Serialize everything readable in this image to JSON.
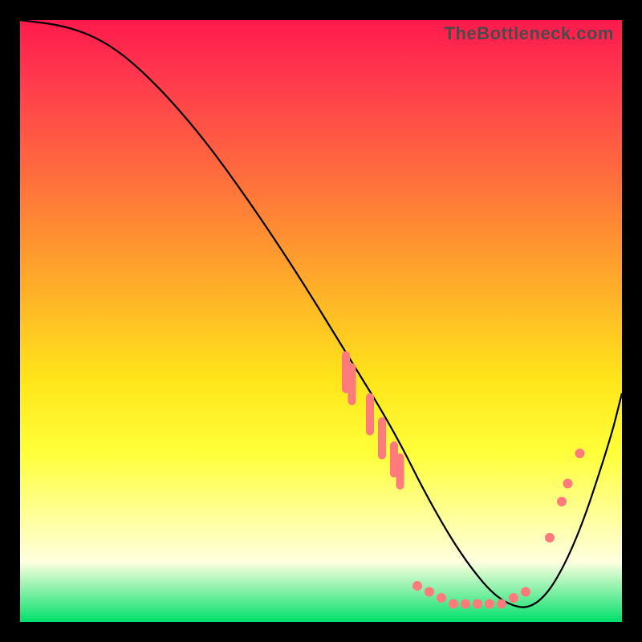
{
  "watermark": "TheBottleneck.com",
  "chart_data": {
    "type": "line",
    "title": "",
    "xlabel": "",
    "ylabel": "",
    "xlim": [
      0,
      100
    ],
    "ylim": [
      0,
      100
    ],
    "x": [
      0,
      8,
      15,
      22,
      30,
      38,
      46,
      54,
      62,
      68,
      74,
      80,
      86,
      92,
      98,
      100
    ],
    "values": [
      100,
      99,
      96,
      90,
      81,
      70,
      58,
      45,
      32,
      20,
      10,
      3,
      2,
      12,
      30,
      38
    ],
    "annotations": {
      "curve_highlight_bars": [
        {
          "x": 54,
          "y_top": 45,
          "y_bot": 38
        },
        {
          "x": 55,
          "y_top": 43,
          "y_bot": 36
        },
        {
          "x": 58,
          "y_top": 38,
          "y_bot": 31
        },
        {
          "x": 60,
          "y_top": 34,
          "y_bot": 27
        },
        {
          "x": 62,
          "y_top": 30,
          "y_bot": 24
        },
        {
          "x": 63,
          "y_top": 28,
          "y_bot": 22
        }
      ],
      "bottom_dots": [
        {
          "x": 66,
          "y": 6
        },
        {
          "x": 68,
          "y": 5
        },
        {
          "x": 70,
          "y": 4
        },
        {
          "x": 72,
          "y": 3
        },
        {
          "x": 74,
          "y": 3
        },
        {
          "x": 76,
          "y": 3
        },
        {
          "x": 78,
          "y": 3
        },
        {
          "x": 80,
          "y": 3
        },
        {
          "x": 82,
          "y": 4
        },
        {
          "x": 84,
          "y": 5
        }
      ],
      "rising_dots": [
        {
          "x": 88,
          "y": 14
        },
        {
          "x": 90,
          "y": 20
        },
        {
          "x": 91,
          "y": 23
        },
        {
          "x": 93,
          "y": 28
        }
      ]
    }
  }
}
